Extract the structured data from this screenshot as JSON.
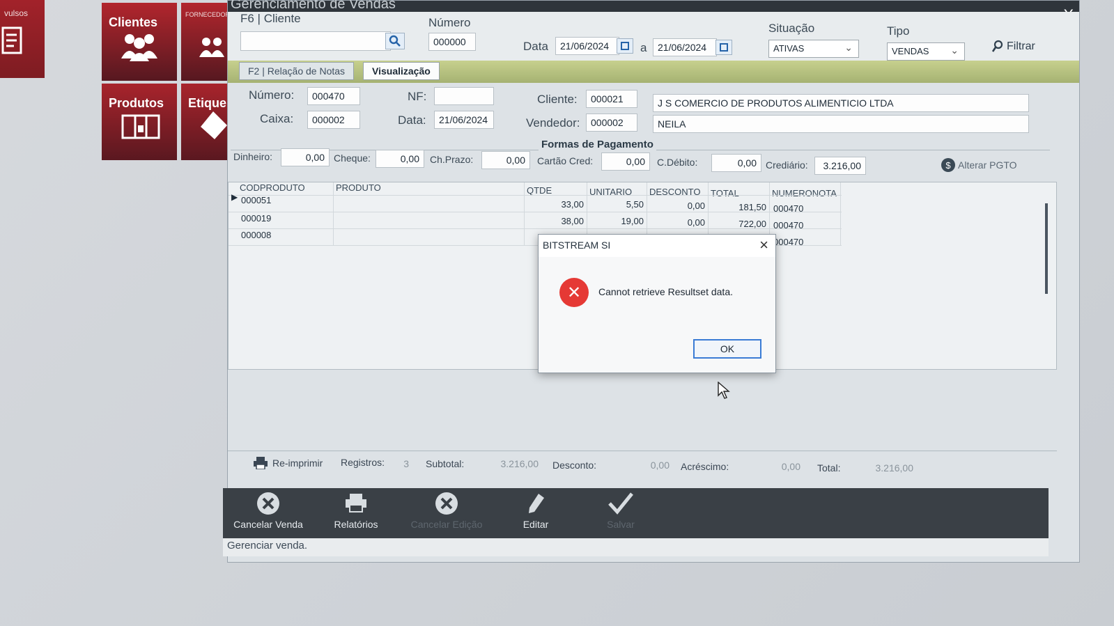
{
  "tiles": {
    "avulsos": "vulsos",
    "clientes": "Clientes",
    "fornecedores": "FORNECEDORES",
    "produtos": "Produtos",
    "etiquetas": "Etique"
  },
  "window": {
    "title": "Gerenciamento de Vendas",
    "close": "X"
  },
  "filter": {
    "cliente_label": "F6 | Cliente",
    "numero_label": "Número",
    "numero_value": "000000",
    "data_label": "Data",
    "data_from": "21/06/2024",
    "data_sep": "a",
    "data_to": "21/06/2024",
    "situacao_label": "Situação",
    "situacao_value": "ATIVAS",
    "tipo_label": "Tipo",
    "tipo_value": "VENDAS",
    "filtrar": "Filtrar"
  },
  "tabs": [
    {
      "label": "F2 | Relação de Notas"
    },
    {
      "label": "Visualização"
    }
  ],
  "detail": {
    "numero_label": "Número:",
    "numero_value": "000470",
    "nf_label": "NF:",
    "nf_value": "",
    "cliente_label": "Cliente:",
    "cliente_code": "000021",
    "cliente_name": "J S COMERCIO DE PRODUTOS ALIMENTICIO LTDA",
    "caixa_label": "Caixa:",
    "caixa_value": "000002",
    "data_label": "Data:",
    "data_value": "21/06/2024",
    "vendedor_label": "Vendedor:",
    "vendedor_code": "000002",
    "vendedor_name": "NEILA"
  },
  "payments": {
    "title": "Formas de Pagamento",
    "dinheiro_label": "Dinheiro:",
    "dinheiro": "0,00",
    "cheque_label": "Cheque:",
    "cheque": "0,00",
    "chprazo_label": "Ch.Prazo:",
    "chprazo": "0,00",
    "cartao_label": "Cartão Cred:",
    "cartao": "0,00",
    "debito_label": "C.Débito:",
    "debito": "0,00",
    "crediario_label": "Crediário:",
    "crediario": "3.216,00",
    "alterar": "Alterar PGTO"
  },
  "grid": {
    "headers": {
      "codproduto": "CODPRODUTO",
      "produto": "PRODUTO",
      "qtde": "QTDE",
      "unitario": "UNITARIO",
      "desconto": "DESCONTO",
      "total": "TOTAL",
      "numeronota": "NUMERONOTA"
    },
    "rows": [
      {
        "cod": "000051",
        "qtde": "33,00",
        "unit": "5,50",
        "desc": "0,00",
        "total": "181,50",
        "nota": "000470"
      },
      {
        "cod": "000019",
        "qtde": "38,00",
        "unit": "19,00",
        "desc": "0,00",
        "total": "722,00",
        "nota": "000470"
      },
      {
        "cod": "000008",
        "qtde": "",
        "unit": "",
        "desc": "",
        "total": "",
        "nota": "000470"
      }
    ]
  },
  "summary": {
    "reimprimir": "Re-imprimir",
    "registros_label": "Registros:",
    "registros": "3",
    "subtotal_label": "Subtotal:",
    "subtotal": "3.216,00",
    "desconto_label": "Desconto:",
    "desconto": "0,00",
    "acrescimo_label": "Acréscimo:",
    "acrescimo": "0,00",
    "total_label": "Total:",
    "total": "3.216,00"
  },
  "actions": {
    "cancelar_venda": "Cancelar Venda",
    "relatorios": "Relatórios",
    "cancelar_edicao": "Cancelar Edição",
    "editar": "Editar",
    "salvar": "Salvar"
  },
  "status": "Gerenciar venda.",
  "dialog": {
    "title": "BITSTREAM SI",
    "message": "Cannot retrieve Resultset data.",
    "ok": "OK"
  }
}
